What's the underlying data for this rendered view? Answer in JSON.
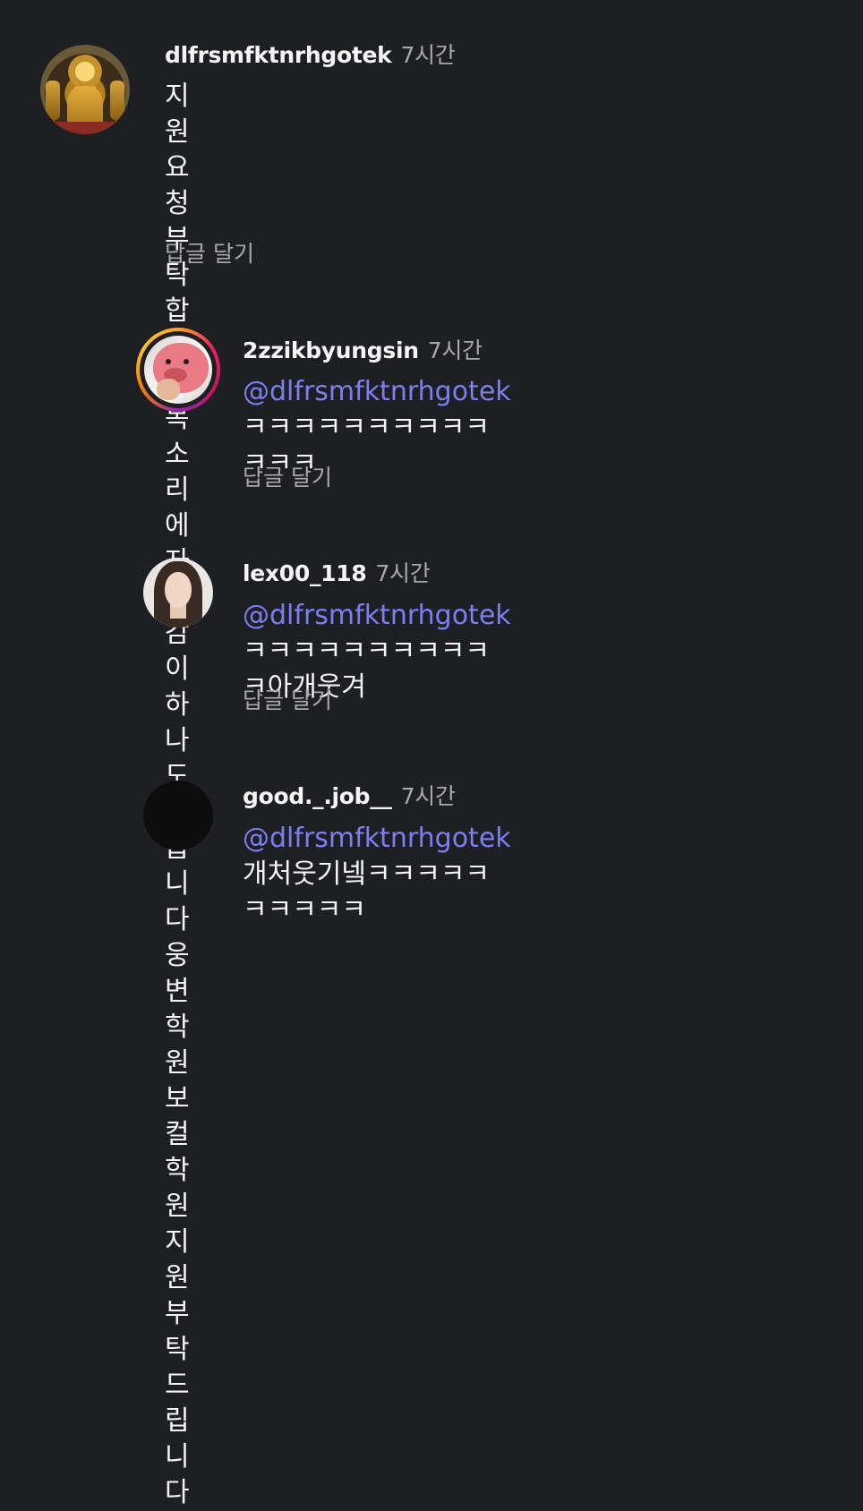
{
  "comments": [
    {
      "username": "dlfrsmfktnrhgotek",
      "time": "7시간",
      "text": "지원 요청 부탁합니다\n목소리에 자신감이 하나도 없습니다\n웅변학원 보컬학원\n지원부탁드립니다",
      "reply_label": "답글 달기",
      "avatar": "buddha-statue-avatar"
    },
    {
      "username": "2zzikbyungsin",
      "time": "7시간",
      "mention": "@dlfrsmfktnrhgotek",
      "text": " ㅋㅋㅋㅋㅋㅋㅋㅋㅋㅋ\nㅋㅋㅋ",
      "reply_label": "답글 달기",
      "avatar": "pink-character-avatar-with-story-ring"
    },
    {
      "username": "lex00_118",
      "time": "7시간",
      "mention": "@dlfrsmfktnrhgotek",
      "text": " ㅋㅋㅋㅋㅋㅋㅋㅋㅋㅋ\nㅋ아개웃겨",
      "reply_label": "답글 달기",
      "avatar": "woman-portrait-avatar"
    },
    {
      "username": "good._.job__",
      "time": "7시간",
      "mention": "@dlfrsmfktnrhgotek",
      "text": " 개처웃기넼ㅋㅋㅋㅋㅋ\nㅋㅋㅋㅋㅋ",
      "avatar": "black-avatar"
    }
  ]
}
